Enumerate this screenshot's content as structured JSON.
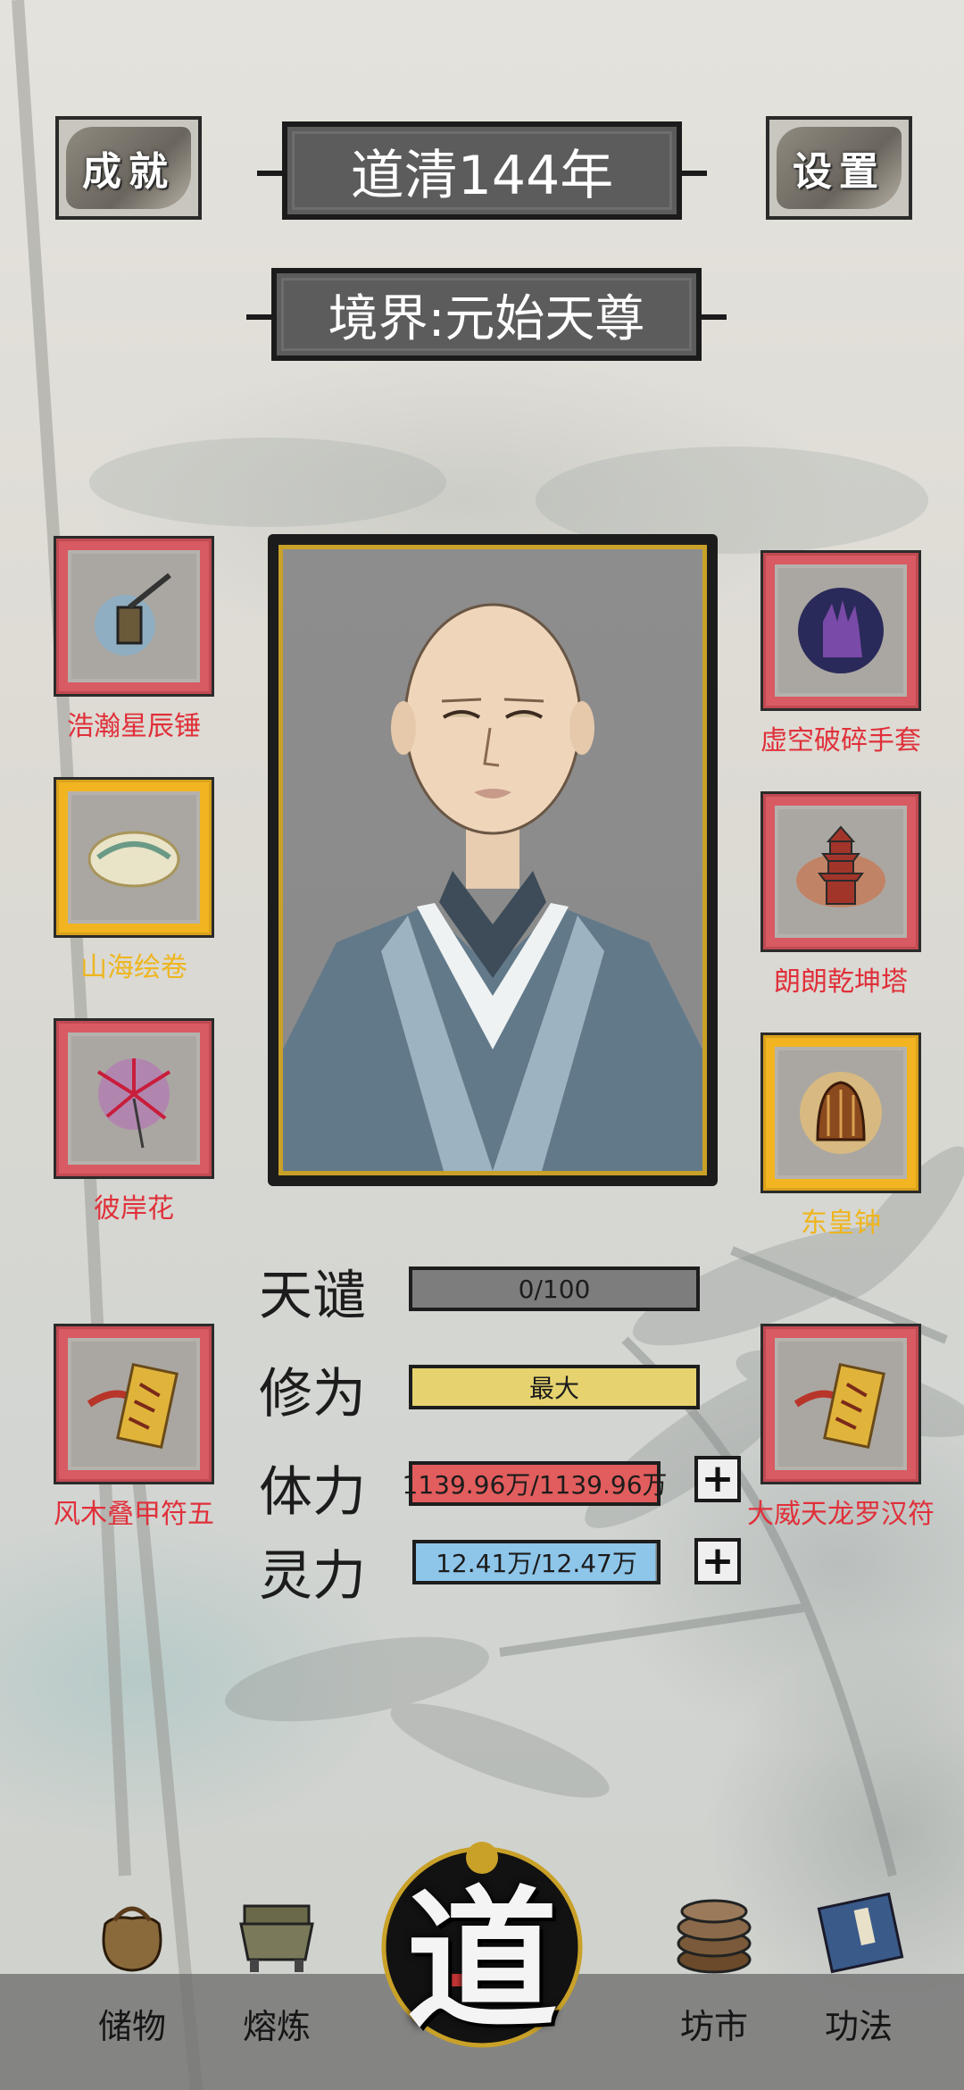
{
  "header": {
    "achievement_label": "成就",
    "settings_label": "设置",
    "year_title": "道清144年",
    "realm_title": "境界:元始天尊"
  },
  "equipment": {
    "left": [
      {
        "name": "浩瀚星辰锤",
        "tier": "red"
      },
      {
        "name": "山海绘卷",
        "tier": "gold"
      },
      {
        "name": "彼岸花",
        "tier": "red"
      },
      {
        "name": "风木叠甲符五",
        "tier": "red"
      }
    ],
    "right": [
      {
        "name": "虚空破碎手套",
        "tier": "red"
      },
      {
        "name": "朗朗乾坤塔",
        "tier": "red"
      },
      {
        "name": "东皇钟",
        "tier": "gold"
      },
      {
        "name": "大威天龙罗汉符",
        "tier": "red"
      }
    ]
  },
  "stats": {
    "tribulation": {
      "label": "天谴",
      "value": "0/100",
      "fill": 0.0,
      "color": "#7d7d7d"
    },
    "cultivation": {
      "label": "修为",
      "value": "最大",
      "fill": 1.0,
      "color": "#e6d36f"
    },
    "stamina": {
      "label": "体力",
      "value": "1139.96万/1139.96万",
      "fill": 1.0,
      "color": "#e25d5d"
    },
    "spirit": {
      "label": "灵力",
      "value": "12.41万/12.47万",
      "fill": 0.995,
      "color": "#8ec6ea"
    }
  },
  "nav": {
    "storage": "储物",
    "smelting": "熔炼",
    "center_glyph": "道",
    "market": "坊市",
    "techniques": "功法"
  },
  "icons": {
    "plus": "plus-icon"
  }
}
